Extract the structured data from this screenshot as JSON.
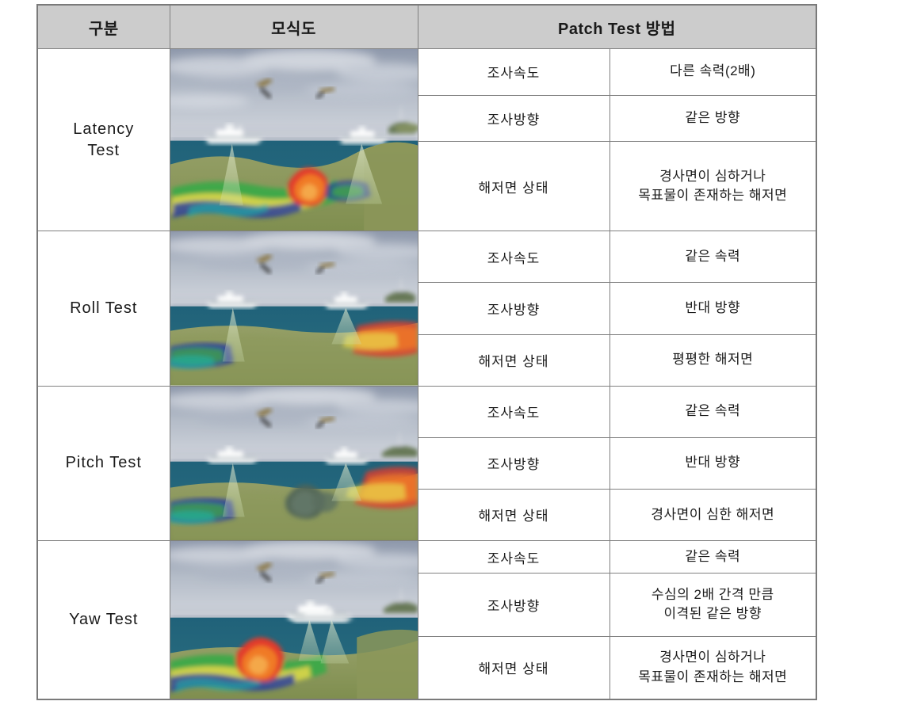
{
  "table": {
    "headers": [
      {
        "label": "구분",
        "name": "header-category"
      },
      {
        "label": "모식도",
        "name": "header-schematic"
      },
      {
        "label": "Patch Test 방법",
        "name": "header-method"
      }
    ],
    "rows": [
      {
        "test": "Latency\nTest",
        "test_line1": "Latency",
        "test_line2": "Test",
        "figure_alt": "다중빔 음향측심 조사 모식도 - 두 척의 선박, 해저 지형 채색도",
        "items": [
          {
            "key": "조사속도",
            "value": "다른 속력(2배)"
          },
          {
            "key": "조사방향",
            "value": "같은 방향"
          },
          {
            "key": "해저면 상태",
            "value": "경사면이 심하거나\n목표물이 존재하는 해저면",
            "value_line1": "경사면이 심하거나",
            "value_line2": "목표물이 존재하는 해저면"
          }
        ]
      },
      {
        "test": "Roll Test",
        "test_line1": "Roll Test",
        "test_line2": "",
        "figure_alt": "다중빔 음향측심 조사 모식도 - 평평한 해저면",
        "items": [
          {
            "key": "조사속도",
            "value": "같은 속력"
          },
          {
            "key": "조사방향",
            "value": "반대 방향"
          },
          {
            "key": "해저면 상태",
            "value": "평평한 해저면",
            "value_line1": "평평한 해저면",
            "value_line2": ""
          }
        ]
      },
      {
        "test": "Pitch Test",
        "test_line1": "Pitch Test",
        "test_line2": "",
        "figure_alt": "다중빔 음향측심 조사 모식도 - 경사면이 심한 해저면",
        "items": [
          {
            "key": "조사속도",
            "value": "같은 속력"
          },
          {
            "key": "조사방향",
            "value": "반대 방향"
          },
          {
            "key": "해저면 상태",
            "value": "경사면이 심한 해저면",
            "value_line1": "경사면이 심한 해저면",
            "value_line2": ""
          }
        ]
      },
      {
        "test": "Yaw Test",
        "test_line1": "Yaw Test",
        "test_line2": "",
        "figure_alt": "다중빔 음향측심 조사 모식도 - 나란한 두 측선",
        "items": [
          {
            "key": "조사속도",
            "value": "같은 속력"
          },
          {
            "key": "조사방향",
            "value": "수심의 2배 간격 만큼\n이격된 같은 방향",
            "value_line1": "수심의 2배 간격 만큼",
            "value_line2": "이격된 같은 방향"
          },
          {
            "key": "해저면 상태",
            "value": "경사면이 심하거나\n목표물이 존재하는 해저면",
            "value_line1": "경사면이 심하거나",
            "value_line2": "목표물이 존재하는 해저면"
          }
        ]
      }
    ]
  },
  "colors": {
    "header_background": "#cccccc",
    "border": "#808080",
    "text": "#1c1c1c",
    "sky_top": "#9aa3b4",
    "sky_low": "#c9cdd6",
    "sea_surface": "#b8c2cd",
    "water": "#1f5f72",
    "seafloor_green": "#8d9a5e",
    "bathy_blue": "#2337a0",
    "bathy_green": "#3fa84a",
    "bathy_yellow": "#e8d84a",
    "bathy_orange": "#f07a28",
    "bathy_red": "#e23b2a",
    "beam": "#dfe8c8"
  }
}
